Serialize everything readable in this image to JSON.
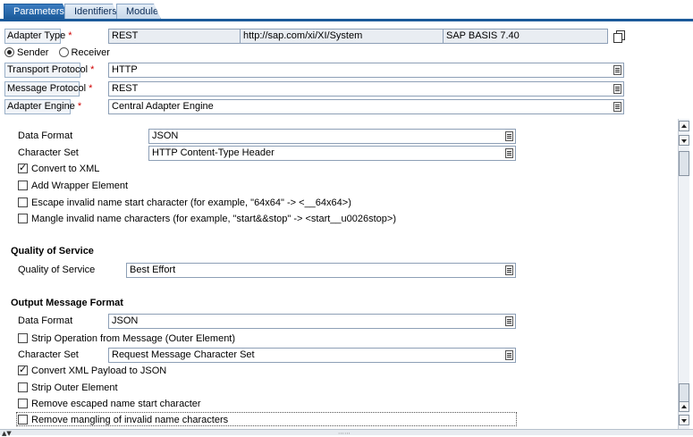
{
  "tabs": [
    {
      "label": "Parameters",
      "active": true
    },
    {
      "label": "Identifiers",
      "active": false
    },
    {
      "label": "Module",
      "active": false
    }
  ],
  "header": {
    "adapter_type_label": "Adapter Type",
    "adapter_type_value": "REST",
    "adapter_type_namespace": "http://sap.com/xi/XI/System",
    "adapter_type_swcv": "SAP BASIS 7.40",
    "required_marker": "*",
    "direction": {
      "sender": "Sender",
      "receiver": "Receiver",
      "selected": "Sender"
    },
    "transport_protocol_label": "Transport Protocol",
    "transport_protocol_value": "HTTP",
    "message_protocol_label": "Message Protocol",
    "message_protocol_value": "REST",
    "adapter_engine_label": "Adapter Engine",
    "adapter_engine_value": "Central Adapter Engine"
  },
  "input_format": {
    "data_format_label": "Data Format",
    "data_format_value": "JSON",
    "charset_label": "Character Set",
    "charset_value": "HTTP Content-Type Header",
    "convert_to_xml": {
      "label": "Convert to XML",
      "checked": true
    },
    "add_wrapper": {
      "label": "Add Wrapper Element",
      "checked": false
    },
    "escape_invalid": {
      "label": "Escape invalid name start character (for example, \"64x64\" -> <__64x64>)",
      "checked": false
    },
    "mangle_invalid": {
      "label": "Mangle invalid name characters (for example, \"start&&stop\" -> <start__u0026stop>)",
      "checked": false
    }
  },
  "qos": {
    "heading": "Quality of Service",
    "label": "Quality of Service",
    "value": "Best Effort"
  },
  "output_format": {
    "heading": "Output Message Format",
    "data_format_label": "Data Format",
    "data_format_value": "JSON",
    "strip_operation": {
      "label": "Strip Operation from Message (Outer Element)",
      "checked": false
    },
    "charset_label": "Character Set",
    "charset_value": "Request Message Character Set",
    "convert_xml_json": {
      "label": "Convert XML Payload to JSON",
      "checked": true
    },
    "strip_outer": {
      "label": "Strip Outer Element",
      "checked": false
    },
    "remove_escaped": {
      "label": "Remove escaped name start character",
      "checked": false
    },
    "remove_mangling": {
      "label": "Remove mangling of invalid name characters",
      "checked": false
    }
  },
  "icons": {
    "dropdown": "value-help-icon",
    "copy": "copy-icon",
    "scroll_up": "up-arrow",
    "scroll_down": "down-arrow"
  },
  "colors": {
    "tab_active": "#1b5a9a",
    "required": "#d00000"
  }
}
